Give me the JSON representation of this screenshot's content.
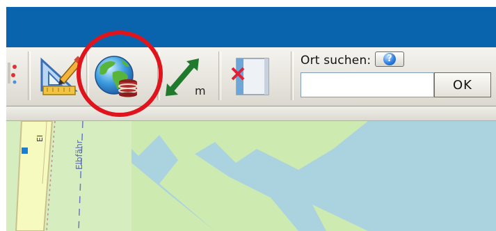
{
  "toolbar": {
    "buttons": [
      {
        "icon": "marker-icon"
      },
      {
        "icon": "measure-triangle-pencil-icon"
      },
      {
        "icon": "globe-database-icon",
        "highlighted": true
      },
      {
        "icon": "distance-measure-icon",
        "unit_label": "m"
      },
      {
        "icon": "clear-route-icon"
      }
    ],
    "search": {
      "label": "Ort suchen:",
      "help_label": "?",
      "value": "",
      "ok_label": "OK"
    }
  },
  "map": {
    "street_label": "Elbfähr",
    "street_label_short": "El"
  },
  "colors": {
    "titlebar": "#0a63ad",
    "highlight": "#e0141c",
    "water": "#aad3df",
    "park": "#cdebb0",
    "road": "#f7fabf"
  }
}
